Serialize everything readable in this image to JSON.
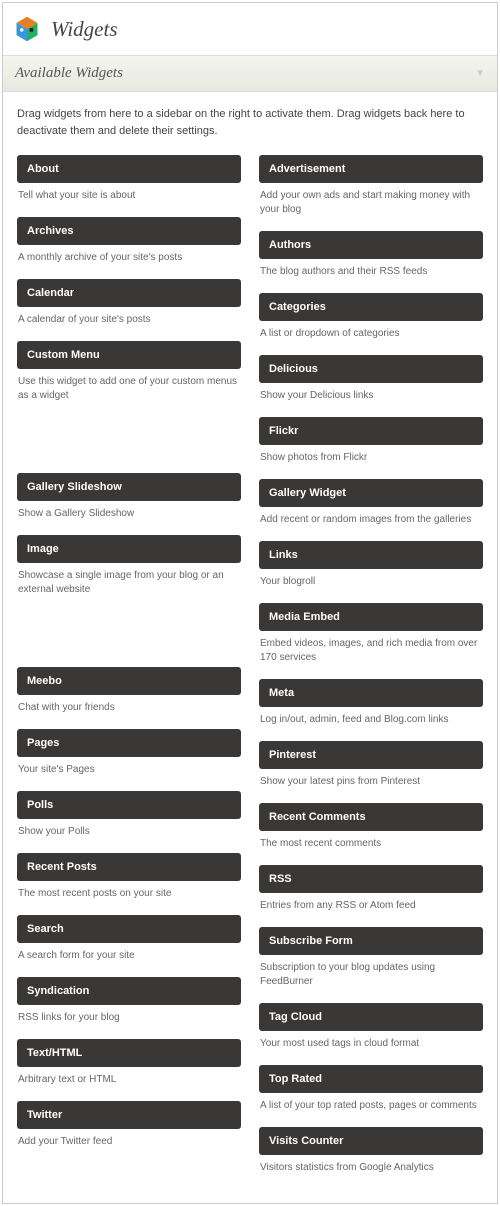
{
  "header": {
    "title": "Widgets"
  },
  "panel": {
    "title": "Available Widgets"
  },
  "intro": "Drag widgets from here to a sidebar on the right to activate them. Drag widgets back here to deactivate them and delete their settings.",
  "left": [
    {
      "title": "About",
      "desc": "Tell what your site is about"
    },
    {
      "title": "Archives",
      "desc": "A monthly archive of your site's posts"
    },
    {
      "title": "Calendar",
      "desc": "A calendar of your site's posts"
    },
    {
      "title": "Custom Menu",
      "desc": "Use this widget to add one of your custom menus as a widget"
    },
    {
      "spacer": true
    },
    {
      "title": "Gallery Slideshow",
      "desc": "Show a Gallery Slideshow"
    },
    {
      "title": "Image",
      "desc": "Showcase a single image from your blog or an external website"
    },
    {
      "spacer": true
    },
    {
      "title": "Meebo",
      "desc": "Chat with your friends"
    },
    {
      "title": "Pages",
      "desc": "Your site's Pages"
    },
    {
      "title": "Polls",
      "desc": "Show your Polls"
    },
    {
      "title": "Recent Posts",
      "desc": "The most recent posts on your site"
    },
    {
      "title": "Search",
      "desc": "A search form for your site"
    },
    {
      "title": "Syndication",
      "desc": "RSS links for your blog"
    },
    {
      "title": "Text/HTML",
      "desc": "Arbitrary text or HTML"
    },
    {
      "title": "Twitter",
      "desc": "Add your Twitter feed"
    }
  ],
  "right": [
    {
      "title": "Advertisement",
      "desc": "Add your own ads and start making money with your blog"
    },
    {
      "title": "Authors",
      "desc": "The blog authors and their RSS feeds"
    },
    {
      "title": "Categories",
      "desc": "A list or dropdown of categories"
    },
    {
      "title": "Delicious",
      "desc": "Show your Delicious links"
    },
    {
      "title": "Flickr",
      "desc": "Show photos from Flickr"
    },
    {
      "title": "Gallery Widget",
      "desc": "Add recent or random images from the galleries"
    },
    {
      "title": "Links",
      "desc": "Your blogroll"
    },
    {
      "title": "Media Embed",
      "desc": "Embed videos, images, and rich media from over 170 services"
    },
    {
      "title": "Meta",
      "desc": "Log in/out, admin, feed and Blog.com links"
    },
    {
      "title": "Pinterest",
      "desc": "Show your latest pins from Pinterest"
    },
    {
      "title": "Recent Comments",
      "desc": "The most recent comments"
    },
    {
      "title": "RSS",
      "desc": "Entries from any RSS or Atom feed"
    },
    {
      "title": "Subscribe Form",
      "desc": "Subscription to your blog updates using FeedBurner"
    },
    {
      "title": "Tag Cloud",
      "desc": "Your most used tags in cloud format"
    },
    {
      "title": "Top Rated",
      "desc": "A list of your top rated posts, pages or comments"
    },
    {
      "title": "Visits Counter",
      "desc": "Visitors statistics from Google Analytics"
    }
  ]
}
